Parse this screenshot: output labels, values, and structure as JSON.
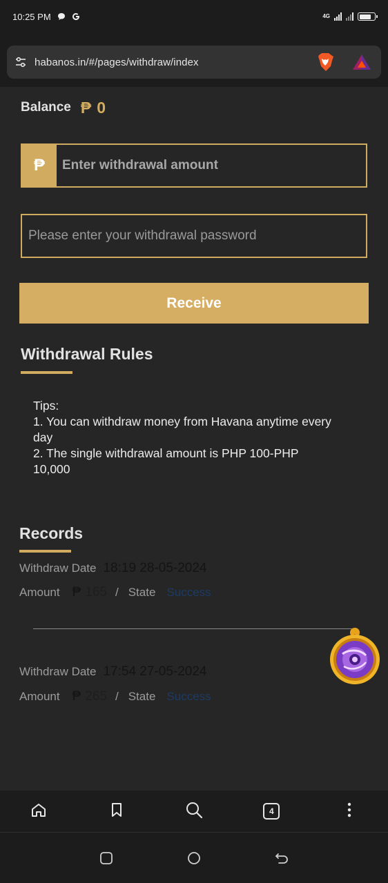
{
  "status_bar": {
    "time": "10:25 PM",
    "app_icons": [
      "chat-bubble-icon",
      "google-g-icon"
    ],
    "network": "4G",
    "battery_level": 0.8
  },
  "browser": {
    "url": "habanos.in/#/pages/withdraw/index",
    "tab_count": "4",
    "toolbar": [
      "home-icon",
      "bookmark-icon",
      "search-icon",
      "tabs-icon",
      "menu-icon"
    ]
  },
  "balance": {
    "label": "Balance",
    "currency": "₱",
    "value": "0"
  },
  "withdraw_form": {
    "amount_prefix": "₱",
    "amount_placeholder": "Enter withdrawal amount",
    "amount_value": "",
    "password_placeholder": "Please enter your withdrawal password",
    "password_value": "",
    "submit_label": "Receive"
  },
  "rules": {
    "title": "Withdrawal Rules",
    "lines": [
      "Tips:",
      "1. You can withdraw money from Havana anytime every day",
      "2. The single withdrawal amount is PHP 100-PHP 10,000"
    ]
  },
  "records": {
    "title": "Records",
    "date_label": "Withdraw Date",
    "amount_label": "Amount",
    "separator": "/",
    "state_label": "State",
    "currency": "₱",
    "items": [
      {
        "date": "18:19 28-05-2024",
        "amount": "165",
        "state": "Success"
      },
      {
        "date": "17:54 27-05-2024",
        "amount": "265",
        "state": "Success"
      }
    ]
  },
  "colors": {
    "accent": "#d6ae63",
    "background": "#262626",
    "bars": "#1c1c1c",
    "state_success": "#1d3a63"
  }
}
